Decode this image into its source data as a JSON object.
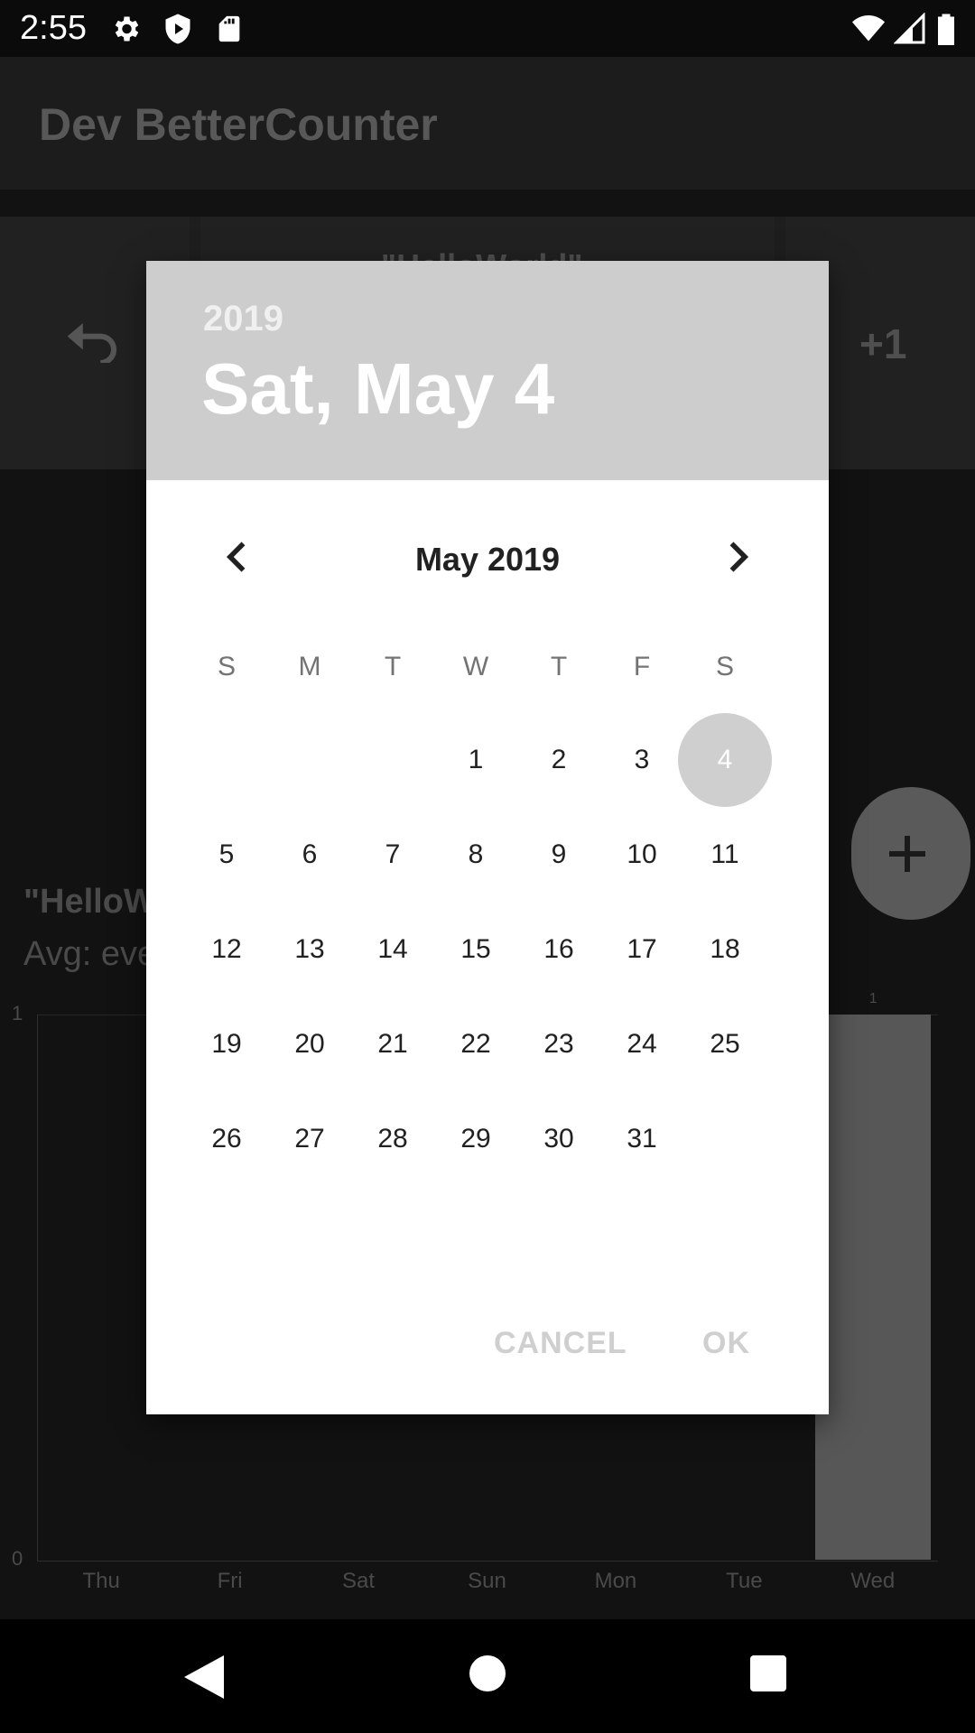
{
  "status_bar": {
    "time": "2:55",
    "icons": [
      "settings-icon",
      "play-protect-icon",
      "sd-card-icon",
      "wifi-icon",
      "signal-icon",
      "battery-icon"
    ]
  },
  "app_bar": {
    "title": "Dev BetterCounter"
  },
  "background": {
    "counter_name": "\"HelloWorld\"",
    "increment_label": "+1",
    "stats_title": "\"HelloW",
    "stats_avg": "Avg: eve"
  },
  "chart_data": {
    "type": "bar",
    "categories": [
      "Thu",
      "Fri",
      "Sat",
      "Sun",
      "Mon",
      "Tue",
      "Wed"
    ],
    "values": [
      0,
      0,
      0,
      0,
      0,
      0,
      1
    ],
    "ylim": [
      0,
      1
    ],
    "y_tick_labels": [
      "0",
      "1"
    ],
    "data_labels": [
      "",
      "",
      "",
      "",
      "",
      "",
      "1"
    ]
  },
  "dialog": {
    "year": "2019",
    "selected_date": "Sat, May 4",
    "month_label": "May 2019",
    "weekdays": [
      "S",
      "M",
      "T",
      "W",
      "T",
      "F",
      "S"
    ],
    "first_weekday_index": 3,
    "days_in_month": 31,
    "selected_day": 4,
    "cancel_label": "CANCEL",
    "ok_label": "OK"
  },
  "colors": {
    "header_bg": "#cdcdcd",
    "selected_day_bg": "#cfcfcf",
    "button_text": "#cfcfcf"
  }
}
